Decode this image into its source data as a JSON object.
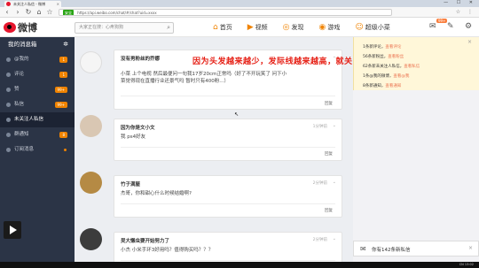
{
  "browser": {
    "tab_title": "未关注人私信 - 微博",
    "tab_close": "×",
    "url_secure": "安全",
    "url": "https://api.weibo.com/chat/#/chat?uid=xxxx",
    "window_controls": "— ☐ ✕",
    "toolbar_icons": "☆ ⋮"
  },
  "header": {
    "logo": "微博",
    "search_placeholder": "大家正在搜：心疼狗狗",
    "nav": [
      {
        "icon": "⌂",
        "label": "首页"
      },
      {
        "icon": "▶",
        "label": "视频"
      },
      {
        "icon": "◎",
        "label": "发现"
      },
      {
        "icon": "◉",
        "label": "游戏"
      },
      {
        "icon": "☺",
        "label": "超级小菜"
      }
    ],
    "new_badge": "99+"
  },
  "sidebar": {
    "title": "我的消息箱",
    "items": [
      {
        "label": "@我的",
        "count": "1"
      },
      {
        "label": "评论",
        "count": "1"
      },
      {
        "label": "赞",
        "count": "99+"
      },
      {
        "label": "私信",
        "count": "99+"
      },
      {
        "label": "未关注人私信",
        "count": ""
      },
      {
        "label": "群通知",
        "count": "8"
      },
      {
        "label": "订阅消息",
        "count": ""
      }
    ]
  },
  "overlay_text": "因为头发越来越少，发际线越来越高，就关了？",
  "messages": [
    {
      "name": "没有男粉丝的乔娜",
      "time": "",
      "text1": "小菜 上个电视 然后最便问一句我17岁20cm正常吗（好了不开玩笑了 问下小",
      "text2": "菜觉得现在直播行业还景气吗 暂时只有400粉...）",
      "reply": "回复"
    },
    {
      "name": "因为你是文小文",
      "time": "1分钟前",
      "text1": "我 ps4好友",
      "text2": "",
      "reply": "回复"
    },
    {
      "name": "竹子满屋",
      "time": "2分钟前",
      "text1": "杰哥，你和甜心什么时候结婚啊?",
      "text2": "",
      "reply": "回复"
    },
    {
      "name": "吴大懒虫要开始努力了",
      "time": "2分钟前",
      "text1": "小杰 小米手环3好用吗？值得购买吗？？？",
      "text2": "",
      "reply": "回复"
    }
  ],
  "notifications": {
    "close": "×",
    "items": [
      {
        "text": "1条新评论，",
        "link": "查看评论"
      },
      {
        "text": "56条新粉丝，",
        "link": "查看粉丝"
      },
      {
        "text": "62条新未关注人私信，",
        "link": "查看私信"
      },
      {
        "text": "1条@我的微博，",
        "link": "查看@我"
      },
      {
        "text": "8条新通知，",
        "link": "查看通知"
      }
    ]
  },
  "toast": {
    "text": "你有142条新私信",
    "close": "×"
  },
  "taskbar": {
    "clock": "CN 13:02"
  },
  "colors": {
    "brand_red": "#e6162d",
    "accent_orange": "#f08300",
    "sidebar_bg": "#2b3446",
    "overlay_red": "#e62117"
  }
}
